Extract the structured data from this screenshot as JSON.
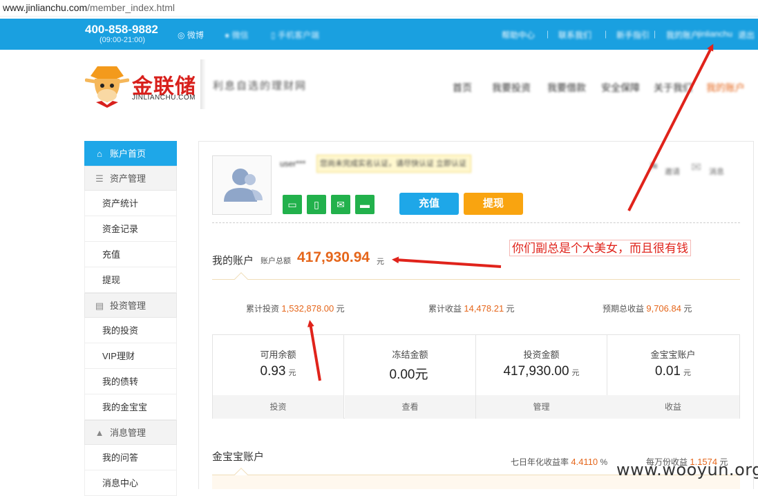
{
  "browser": {
    "url_domain": "www.jinlianchu.com",
    "url_path": "/member_index.html"
  },
  "topbar": {
    "phone": "400-858-9882",
    "hours": "(09:00-21:00)",
    "weibo_label": "微博",
    "wechat_label": "微信",
    "app_label": "手机客户端",
    "links": [
      "帮助中心",
      "联系我们",
      "新手指引",
      "我的账户"
    ],
    "user_name": "jinlianchu",
    "logout": "退出"
  },
  "brand": {
    "logo_text": "金联储",
    "logo_sub": "JINLIANCHU.COM",
    "slogan": "利息自选的理财网"
  },
  "nav": {
    "items": [
      "首页",
      "我要投资",
      "我要借款",
      "安全保障",
      "关于我们",
      "我的账户"
    ]
  },
  "sidebar": {
    "home": "账户首页",
    "asset_head": "资产管理",
    "asset_items": [
      "资产统计",
      "资金记录",
      "充值",
      "提现"
    ],
    "invest_head": "投资管理",
    "invest_items": [
      "我的投资",
      "VIP理财",
      "我的债转",
      "我的金宝宝"
    ],
    "msg_head": "消息管理",
    "msg_items": [
      "我的问答",
      "消息中心"
    ]
  },
  "profile": {
    "username": "user***",
    "notice": "您尚未完成实名认证，请尽快认证 立即认证",
    "recharge_button": "充值",
    "withdraw_button": "提现",
    "right_links": [
      "邀请",
      "消息"
    ]
  },
  "account": {
    "title": "我的账户",
    "total_label": "账户总额",
    "total_value": "417,930.94",
    "unit": "元",
    "stats": [
      {
        "label": "累计投资",
        "value": "1,532,878.00",
        "unit": "元"
      },
      {
        "label": "累计收益",
        "value": "14,478.21",
        "unit": "元"
      },
      {
        "label": "预期总收益",
        "value": "9,706.84",
        "unit": "元"
      }
    ],
    "cells": [
      {
        "label": "可用余额",
        "value": "0.93",
        "unit": "元",
        "action": "投资"
      },
      {
        "label": "冻结金额",
        "value": "0.00元",
        "unit": "",
        "action": "查看"
      },
      {
        "label": "投资金额",
        "value": "417,930.00",
        "unit": "元",
        "action": "管理"
      },
      {
        "label": "金宝宝账户",
        "value": "0.01",
        "unit": "元",
        "action": "收益"
      }
    ]
  },
  "jinbaobao": {
    "title": "金宝宝账户",
    "rate_label": "七日年化收益率",
    "rate_value": "4.4110",
    "rate_unit": "%",
    "income_label": "每万份收益",
    "income_value": "1.1574",
    "income_unit": "元"
  },
  "annotation": {
    "text": "你们副总是个大美女，而且很有钱"
  },
  "watermark": "www.wooyun.org",
  "colors": {
    "topbar": "#1aa0e0",
    "accent_orange": "#e5661b",
    "recharge_blue": "#1ea7e8",
    "withdraw_orange": "#f9a410",
    "verify_green": "#22b14c",
    "annotation_red": "#e0231b"
  }
}
